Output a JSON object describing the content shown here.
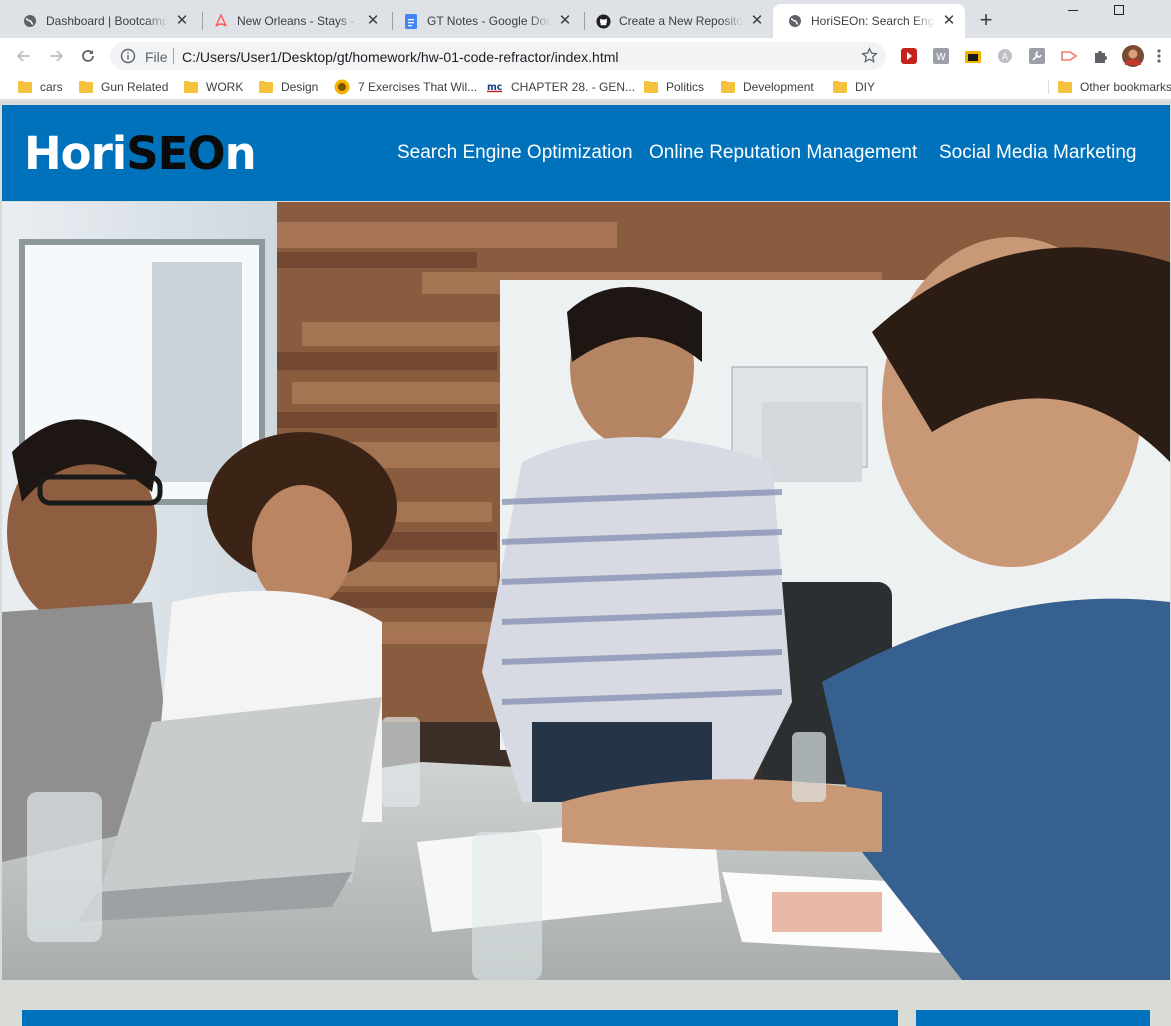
{
  "browser": {
    "tabs": [
      {
        "title": "Dashboard | Bootcamp Spot",
        "icon": "globe-icon"
      },
      {
        "title": "New Orleans - Stays - Airbnb",
        "icon": "airbnb-icon"
      },
      {
        "title": "GT Notes - Google Docs",
        "icon": "google-docs-icon"
      },
      {
        "title": "Create a New Repository",
        "icon": "github-icon"
      },
      {
        "title": "HoriSEOn: Search Engine Optimization",
        "icon": "globe-icon",
        "active": true
      }
    ],
    "new_tab_symbol": "+",
    "close_symbol": "✕",
    "address": {
      "scheme_label": "File",
      "url": "C:/Users/User1/Desktop/gt/homework/hw-01-code-refractor/index.html"
    }
  },
  "bookmarks": {
    "items": [
      {
        "label": "cars",
        "icon": "folder-icon"
      },
      {
        "label": "Gun Related",
        "icon": "folder-icon"
      },
      {
        "label": "WORK",
        "icon": "folder-icon"
      },
      {
        "label": "Design",
        "icon": "folder-icon"
      },
      {
        "label": "7 Exercises That Wil...",
        "icon": "lion-favicon-icon"
      },
      {
        "label": "CHAPTER 28. - GEN...",
        "icon": "mc-favicon-icon"
      },
      {
        "label": "Politics",
        "icon": "folder-icon"
      },
      {
        "label": "Development",
        "icon": "folder-icon"
      },
      {
        "label": "DIY",
        "icon": "folder-icon"
      }
    ],
    "other": "Other bookmarks"
  },
  "site": {
    "logo": {
      "part1": "Hori",
      "part2": "SEO",
      "part3": "n"
    },
    "nav": [
      {
        "label": "Search Engine Optimization"
      },
      {
        "label": "Online Reputation Management"
      },
      {
        "label": "Social Media Marketing"
      }
    ],
    "hero_image": "team-meeting-photo",
    "colors": {
      "brand": "#0072bb",
      "logo_accent": "#0b0b0b",
      "page_bg": "#d9dcd6"
    }
  }
}
